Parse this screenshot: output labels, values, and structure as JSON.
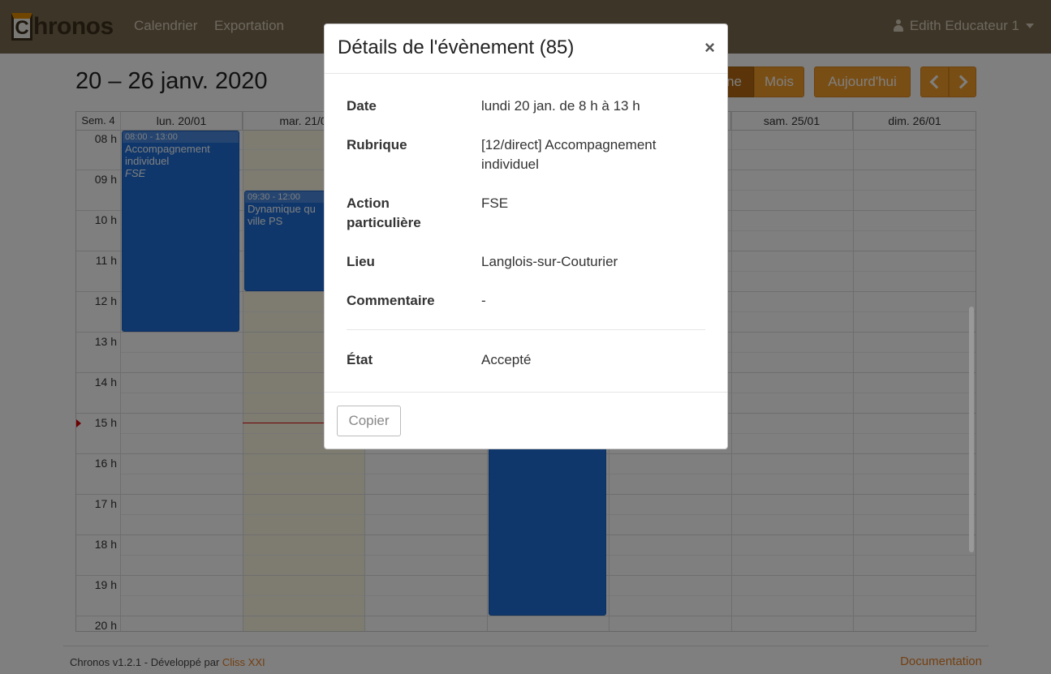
{
  "app": {
    "logo_letter": "C",
    "logo_text": "hronos"
  },
  "nav": {
    "calendar": "Calendrier",
    "export": "Exportation",
    "user": "Edith Educateur 1"
  },
  "calendar": {
    "title": "20 – 26 janv. 2020",
    "week_label": "Sem. 4",
    "view_week_partial": "ne",
    "view_month": "Mois",
    "today": "Aujourd'hui",
    "days": [
      "lun. 20/01",
      "mar. 21/0",
      "",
      "",
      "",
      "sam. 25/01",
      "dim. 26/01"
    ],
    "hours": [
      "08 h",
      "09 h",
      "10 h",
      "11 h",
      "12 h",
      "13 h",
      "14 h",
      "15 h",
      "16 h",
      "17 h",
      "18 h",
      "19 h",
      "20 h"
    ],
    "events": [
      {
        "time": "08:00 - 13:00",
        "title": "Accompagnement individuel",
        "sub": "FSE"
      },
      {
        "time": "09:30 - 12:00",
        "title": "Dynamique qu ville PS"
      }
    ]
  },
  "modal": {
    "title": "Détails de l'évènement (85)",
    "close": "×",
    "rows": [
      {
        "label": "Date",
        "value": "lundi 20 jan. de 8 h à 13 h"
      },
      {
        "label": "Rubrique",
        "value": "[12/direct] Accompagnement individuel"
      },
      {
        "label": "Action particulière",
        "value": "FSE"
      },
      {
        "label": "Lieu",
        "value": "Langlois-sur-Couturier"
      },
      {
        "label": "Commentaire",
        "value": "-"
      },
      {
        "label": "État",
        "value": "Accepté"
      }
    ],
    "copy": "Copier"
  },
  "footer": {
    "text": "Chronos v1.2.1 - Développé par ",
    "link": "Cliss XXI",
    "doc": "Documentation"
  },
  "colors": {
    "navbar": "#7a6a4f",
    "accent": "#f39c2b",
    "event": "#1e6fd9"
  }
}
